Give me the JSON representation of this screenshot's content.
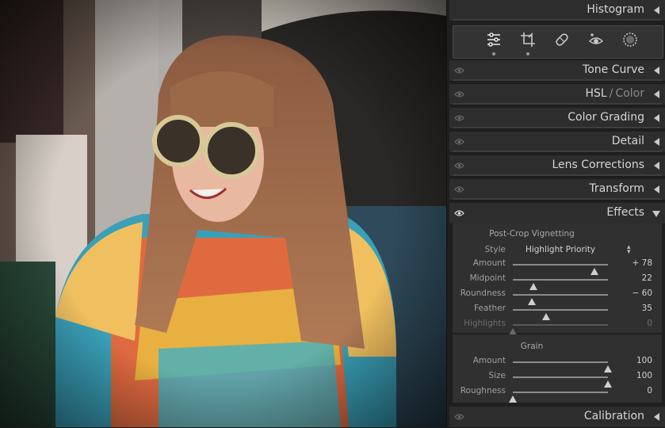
{
  "panels": {
    "histogram": {
      "label": "Histogram"
    },
    "tone_curve": {
      "label": "Tone Curve"
    },
    "hsl": {
      "label_a": "HSL",
      "sep": "/",
      "label_b": "Color"
    },
    "color_grading": {
      "label": "Color Grading"
    },
    "detail": {
      "label": "Detail"
    },
    "lens_corrections": {
      "label": "Lens Corrections"
    },
    "transform": {
      "label": "Transform"
    },
    "effects": {
      "label": "Effects"
    },
    "calibration": {
      "label": "Calibration"
    }
  },
  "tools": [
    "sliders-icon",
    "crop-icon",
    "healing-icon",
    "red-eye-icon",
    "mask-icon"
  ],
  "vignette": {
    "title": "Post-Crop Vignetting",
    "style_label": "Style",
    "style_value": "Highlight Priority",
    "sliders": [
      {
        "label": "Amount",
        "value": "+ 78",
        "pos": 0.86,
        "dim": false
      },
      {
        "label": "Midpoint",
        "value": "22",
        "pos": 0.22,
        "dim": false
      },
      {
        "label": "Roundness",
        "value": "− 60",
        "pos": 0.2,
        "dim": false
      },
      {
        "label": "Feather",
        "value": "35",
        "pos": 0.35,
        "dim": false
      },
      {
        "label": "Highlights",
        "value": "0",
        "pos": 0.0,
        "dim": true
      }
    ]
  },
  "grain": {
    "title": "Grain",
    "sliders": [
      {
        "label": "Amount",
        "value": "100",
        "pos": 1.0
      },
      {
        "label": "Size",
        "value": "100",
        "pos": 1.0
      },
      {
        "label": "Roughness",
        "value": "0",
        "pos": 0.0
      }
    ]
  },
  "colors": {
    "panel_bg": "#1f1f1f",
    "header_bg": "#2d2d2d",
    "section_bg": "#303030",
    "text": "#d6d6d6"
  }
}
